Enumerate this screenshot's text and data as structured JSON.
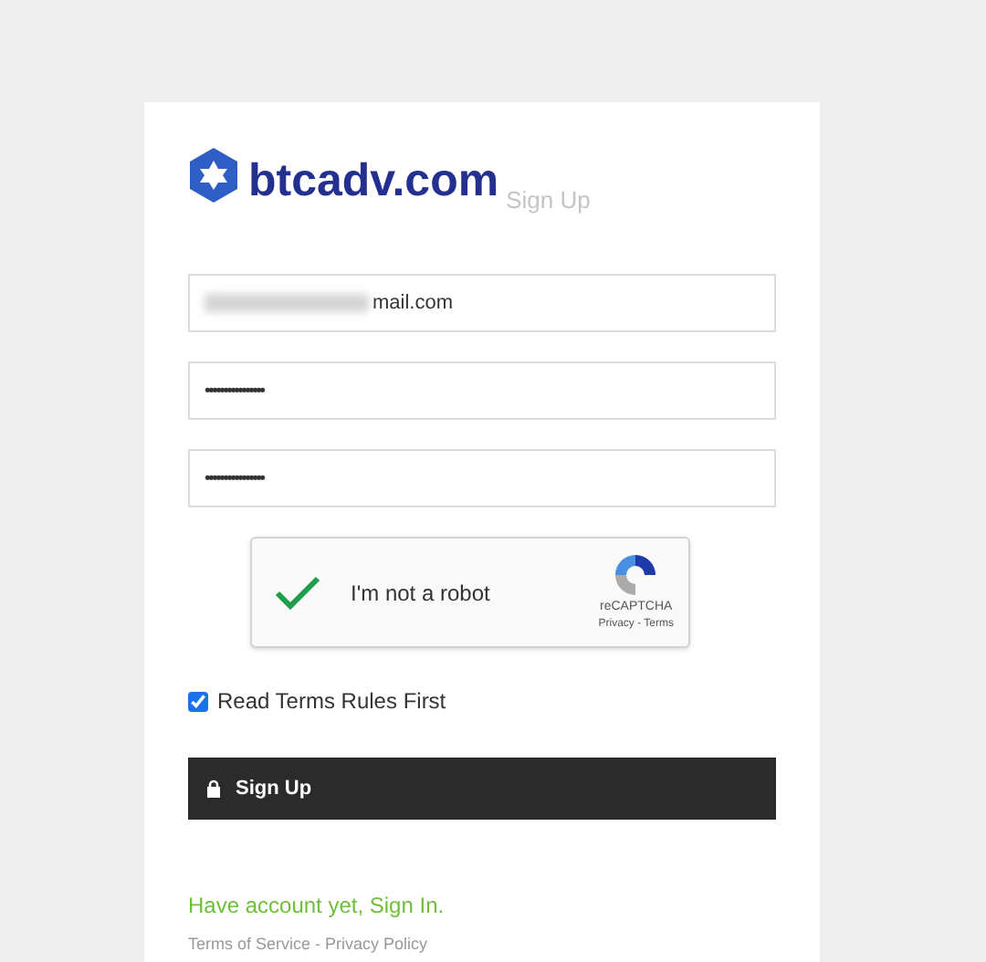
{
  "logo": {
    "text": "btcadv.com"
  },
  "heading": "Sign Up",
  "fields": [
    {
      "kind": "email",
      "value": "mail.com",
      "redacted": true
    },
    {
      "kind": "password",
      "value": "••••••••••••••••"
    },
    {
      "kind": "password",
      "value": "••••••••••••••••"
    }
  ],
  "captcha": {
    "label": "I'm not a robot",
    "checked": true,
    "brand": "reCAPTCHA",
    "links": "Privacy - Terms"
  },
  "terms": {
    "label": "Read Terms Rules First",
    "checked": true
  },
  "submit": {
    "label": "Sign Up"
  },
  "signin_link": "Have account yet, Sign In.",
  "footer_links": [
    "Terms of Service",
    "Privacy Policy"
  ],
  "footer_separator": "-"
}
